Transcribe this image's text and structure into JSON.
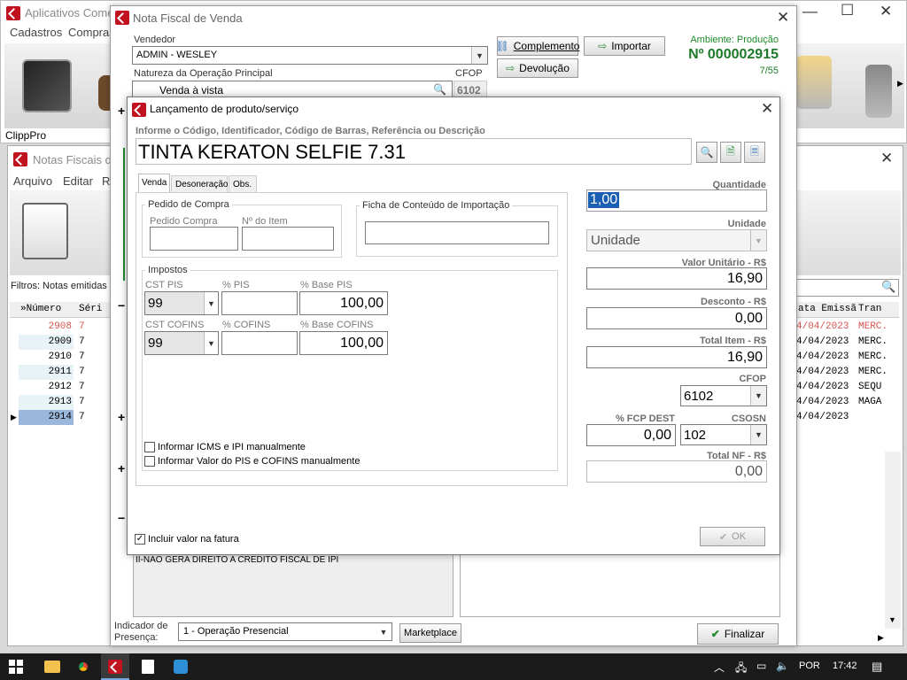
{
  "main_window": {
    "title": "Aplicativos Comer",
    "menu": [
      "Cadastros",
      "Compras"
    ],
    "brand": "ClippPro"
  },
  "notas_window": {
    "title": "Notas Fiscais de",
    "menu": [
      "Arquivo",
      "Editar",
      "Re"
    ],
    "filter": "Filtros: Notas emitidas H",
    "columns": [
      "»Número",
      "Séri"
    ],
    "rows": [
      {
        "numero": "2908",
        "serie": "7",
        "data": "4/04/2023",
        "tran": "MERC."
      },
      {
        "numero": "2909",
        "serie": "7",
        "data": "4/04/2023",
        "tran": "MERC."
      },
      {
        "numero": "2910",
        "serie": "7",
        "data": "4/04/2023",
        "tran": "MERC."
      },
      {
        "numero": "2911",
        "serie": "7",
        "data": "4/04/2023",
        "tran": "MERC."
      },
      {
        "numero": "2912",
        "serie": "7",
        "data": "4/04/2023",
        "tran": "SEQU"
      },
      {
        "numero": "2913",
        "serie": "7",
        "data": "4/04/2023",
        "tran": "MAGA"
      },
      {
        "numero": "2914",
        "serie": "7",
        "data": "4/04/2023",
        "tran": ""
      }
    ],
    "right_columns": [
      "ata Emissã",
      "Tran"
    ]
  },
  "nota_window": {
    "title": "Nota Fiscal de Venda",
    "vendedor_label": "Vendedor",
    "vendedor": "ADMIN - WESLEY",
    "natureza_label": "Natureza da Operação Principal",
    "natureza": "Venda à vista",
    "cfop_label": "CFOP",
    "cfop": "6102",
    "complemento": "Complemento",
    "devolucao": "Devolução",
    "importar": "Importar",
    "ambiente": "Ambiente: Produção",
    "numero": "Nº 000002915",
    "pagina": "7/55",
    "obs_text": "II-NAO GERA DIREITO A CREDITO FISCAL DE IPI",
    "indicador_label1": "Indicador de",
    "indicador_label2": "Presença:",
    "indicador": "1 - Operação Presencial",
    "marketplace": "Marketplace",
    "finalizar": "Finalizar"
  },
  "dialog": {
    "title": "Lançamento de produto/serviço",
    "search_label": "Informe o Código, Identificador, Código de Barras, Referência ou Descrição",
    "product": "TINTA KERATON SELFIE 7.31",
    "tabs": [
      "Venda",
      "Desoneração",
      "Obs."
    ],
    "pedido_group": "Pedido de Compra",
    "pedido_compra_label": "Pedido Compra",
    "item_label": "Nº do Item",
    "ficha_group": "Ficha de Conteúdo de Importação",
    "impostos_group": "Impostos",
    "cst_pis_label": "CST PIS",
    "cst_pis": "99",
    "pct_pis_label": "% PIS",
    "base_pis_label": "% Base PIS",
    "base_pis": "100,00",
    "cst_cofins_label": "CST COFINS",
    "cst_cofins": "99",
    "pct_cofins_label": "% COFINS",
    "base_cofins_label": "% Base COFINS",
    "base_cofins": "100,00",
    "check_icms": "Informar ICMS e IPI manualmente",
    "check_pis": "Informar Valor do PIS e COFINS manualmente",
    "check_fatura": "Incluir valor na fatura",
    "quantidade_label": "Quantidade",
    "quantidade": "1,00",
    "unidade_label": "Unidade",
    "unidade": "Unidade",
    "valor_unit_label": "Valor Unitário - R$",
    "valor_unit": "16,90",
    "desconto_label": "Desconto - R$",
    "desconto": "0,00",
    "total_item_label": "Total Item - R$",
    "total_item": "16,90",
    "cfop_label": "CFOP",
    "cfop": "6102",
    "fcp_label": "% FCP DEST",
    "fcp": "0,00",
    "csosn_label": "CSOSN",
    "csosn": "102",
    "total_nf_label": "Total NF - R$",
    "total_nf": "0,00",
    "ok": "OK"
  },
  "taskbar": {
    "lang": "POR",
    "time": "17:42"
  }
}
